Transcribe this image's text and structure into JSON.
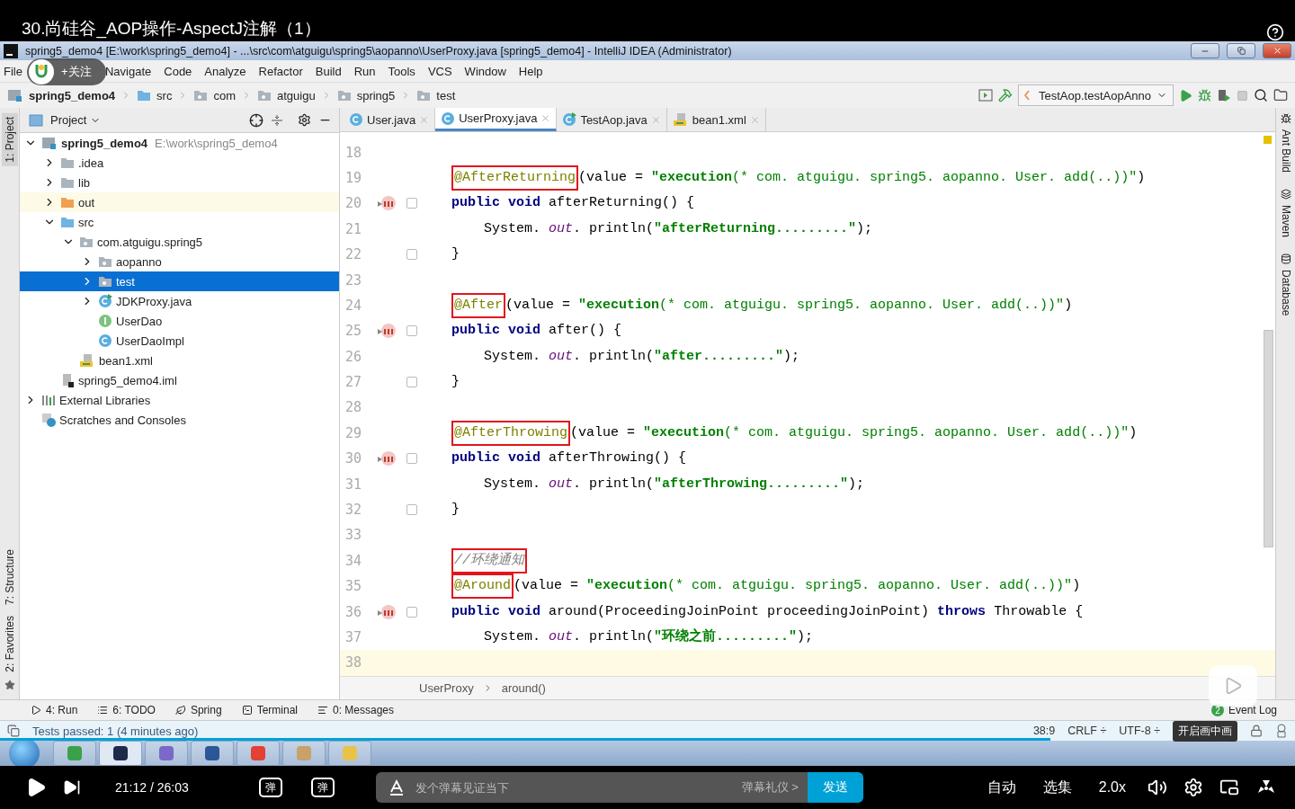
{
  "video_title": "30.尚硅谷_AOP操作-AspectJ注解（1）",
  "window": {
    "title": "spring5_demo4 [E:\\work\\spring5_demo4] - ...\\src\\com\\atguigu\\spring5\\aopanno\\UserProxy.java [spring5_demo4] - IntelliJ IDEA (Administrator)"
  },
  "menu": [
    "File",
    "Navigate",
    "Code",
    "Analyze",
    "Refactor",
    "Build",
    "Run",
    "Tools",
    "VCS",
    "Window",
    "Help"
  ],
  "follow_overlay": {
    "label": "+关注"
  },
  "nav_path": [
    {
      "label": "spring5_demo4",
      "kind": "module"
    },
    {
      "label": "src",
      "kind": "source"
    },
    {
      "label": "com",
      "kind": "package"
    },
    {
      "label": "atguigu",
      "kind": "package"
    },
    {
      "label": "spring5",
      "kind": "package"
    },
    {
      "label": "test",
      "kind": "package"
    }
  ],
  "run_config": "TestAop.testAopAnno",
  "left_strip": [
    {
      "label": "1: Project",
      "selected": true
    },
    {
      "label": "7: Structure",
      "selected": false
    },
    {
      "label": "2: Favorites",
      "selected": false
    }
  ],
  "right_strip": [
    {
      "label": "Ant Build",
      "kind": "ant"
    },
    {
      "label": "Maven",
      "kind": "maven"
    },
    {
      "label": "Database",
      "kind": "database"
    }
  ],
  "project_panel": {
    "title": "Project",
    "tree": [
      {
        "label": "spring5_demo4",
        "note": "E:\\work\\spring5_demo4",
        "kind": "module",
        "expanded": true,
        "selected": false,
        "children": [
          {
            "label": ".idea",
            "kind": "folder",
            "expanded": false,
            "selected": false
          },
          {
            "label": "lib",
            "kind": "folder",
            "expanded": false,
            "selected": false
          },
          {
            "label": "out",
            "kind": "excluded",
            "expanded": false,
            "selected": false
          },
          {
            "label": "src",
            "kind": "source",
            "expanded": true,
            "selected": false,
            "children": [
              {
                "label": "com.atguigu.spring5",
                "kind": "package",
                "expanded": true,
                "selected": false,
                "children": [
                  {
                    "label": "aopanno",
                    "kind": "package",
                    "expanded": false,
                    "selected": false
                  },
                  {
                    "label": "test",
                    "kind": "package",
                    "expanded": false,
                    "selected": true
                  },
                  {
                    "label": "JDKProxy.java",
                    "kind": "class-run",
                    "expanded": false,
                    "selected": false
                  },
                  {
                    "label": "UserDao",
                    "kind": "interface",
                    "selected": false
                  },
                  {
                    "label": "UserDaoImpl",
                    "kind": "class",
                    "selected": false
                  }
                ]
              },
              {
                "label": "bean1.xml",
                "kind": "xml",
                "selected": false
              }
            ]
          },
          {
            "label": "spring5_demo4.iml",
            "kind": "iml",
            "selected": false
          }
        ]
      },
      {
        "label": "External Libraries",
        "kind": "libraries",
        "expanded": false,
        "selected": false
      },
      {
        "label": "Scratches and Consoles",
        "kind": "scratches",
        "selected": false
      }
    ]
  },
  "editor_tabs": [
    {
      "label": "User.java",
      "kind": "class",
      "selected": false
    },
    {
      "label": "UserProxy.java",
      "kind": "class",
      "selected": true
    },
    {
      "label": "TestAop.java",
      "kind": "class-run",
      "selected": false
    },
    {
      "label": "bean1.xml",
      "kind": "xml",
      "selected": false
    }
  ],
  "code": [
    {
      "no": "18"
    },
    {
      "no": "19",
      "segments": [
        {
          "text": "@AfterReturning",
          "kind": "ann",
          "boxed": true
        },
        {
          "text": "(value = ",
          "kind": "plain"
        },
        {
          "text": "\"execution",
          "kind": "strb"
        },
        {
          "text": "(* com. atguigu. spring5. aopanno. User. add(..))\"",
          "kind": "str"
        },
        {
          "text": ")",
          "kind": "plain"
        }
      ]
    },
    {
      "no": "20",
      "advice_marker": true,
      "fold_marker": true,
      "segments": [
        {
          "text": "public void",
          "kind": "kw"
        },
        {
          "text": " afterReturning() {",
          "kind": "plain"
        }
      ],
      "children": [
        {
          "no": "21",
          "segments": [
            {
              "text": "System. ",
              "kind": "plain"
            },
            {
              "text": "out",
              "kind": "static"
            },
            {
              "text": ". println(",
              "kind": "plain"
            },
            {
              "text": "\"afterReturning.........\"",
              "kind": "strb"
            },
            {
              "text": ");",
              "kind": "plain"
            }
          ]
        }
      ]
    },
    {
      "no": "22",
      "fold_marker": true,
      "segments": [
        {
          "text": "}",
          "kind": "plain"
        }
      ]
    },
    {
      "no": "23"
    },
    {
      "no": "24",
      "segments": [
        {
          "text": "@After",
          "kind": "ann",
          "boxed": true
        },
        {
          "text": "(value = ",
          "kind": "plain"
        },
        {
          "text": "\"execution",
          "kind": "strb"
        },
        {
          "text": "(* com. atguigu. spring5. aopanno. User. add(..))\"",
          "kind": "str"
        },
        {
          "text": ")",
          "kind": "plain"
        }
      ]
    },
    {
      "no": "25",
      "advice_marker": true,
      "fold_marker": true,
      "segments": [
        {
          "text": "public void",
          "kind": "kw"
        },
        {
          "text": " after() {",
          "kind": "plain"
        }
      ],
      "children": [
        {
          "no": "26",
          "segments": [
            {
              "text": "System. ",
              "kind": "plain"
            },
            {
              "text": "out",
              "kind": "static"
            },
            {
              "text": ". println(",
              "kind": "plain"
            },
            {
              "text": "\"after.........\"",
              "kind": "strb"
            },
            {
              "text": ");",
              "kind": "plain"
            }
          ]
        }
      ]
    },
    {
      "no": "27",
      "fold_marker": true,
      "segments": [
        {
          "text": "}",
          "kind": "plain"
        }
      ]
    },
    {
      "no": "28"
    },
    {
      "no": "29",
      "segments": [
        {
          "text": "@AfterThrowing",
          "kind": "ann",
          "boxed": true
        },
        {
          "text": "(value = ",
          "kind": "plain"
        },
        {
          "text": "\"execution",
          "kind": "strb"
        },
        {
          "text": "(* com. atguigu. spring5. aopanno. User. add(..))\"",
          "kind": "str"
        },
        {
          "text": ")",
          "kind": "plain"
        }
      ]
    },
    {
      "no": "30",
      "advice_marker": true,
      "fold_marker": true,
      "segments": [
        {
          "text": "public void",
          "kind": "kw"
        },
        {
          "text": " afterThrowing() {",
          "kind": "plain"
        }
      ],
      "children": [
        {
          "no": "31",
          "segments": [
            {
              "text": "System. ",
              "kind": "plain"
            },
            {
              "text": "out",
              "kind": "static"
            },
            {
              "text": ". println(",
              "kind": "plain"
            },
            {
              "text": "\"afterThrowing.........\"",
              "kind": "strb"
            },
            {
              "text": ");",
              "kind": "plain"
            }
          ]
        }
      ]
    },
    {
      "no": "32",
      "fold_marker": true,
      "segments": [
        {
          "text": "}",
          "kind": "plain"
        }
      ]
    },
    {
      "no": "33"
    },
    {
      "no": "34",
      "segments": [
        {
          "text": "//环绕通知",
          "kind": "comment",
          "boxed": true
        }
      ]
    },
    {
      "no": "35",
      "segments": [
        {
          "text": "@Around",
          "kind": "ann",
          "boxed": true
        },
        {
          "text": "(value = ",
          "kind": "plain"
        },
        {
          "text": "\"execution",
          "kind": "strb"
        },
        {
          "text": "(* com. atguigu. spring5. aopanno. User. add(..))\"",
          "kind": "str"
        },
        {
          "text": ")",
          "kind": "plain"
        }
      ]
    },
    {
      "no": "36",
      "advice_marker": true,
      "fold_marker": true,
      "segments": [
        {
          "text": "public void",
          "kind": "kw"
        },
        {
          "text": " around(ProceedingJoinPoint proceedingJoinPoint) ",
          "kind": "plain"
        },
        {
          "text": "throws",
          "kind": "kw"
        },
        {
          "text": " Throwable {",
          "kind": "plain"
        }
      ],
      "children": [
        {
          "no": "37",
          "segments": [
            {
              "text": "System. ",
              "kind": "plain"
            },
            {
              "text": "out",
              "kind": "static"
            },
            {
              "text": ". println(",
              "kind": "plain"
            },
            {
              "text": "\"环绕之前.........\"",
              "kind": "strb"
            },
            {
              "text": ");",
              "kind": "plain"
            }
          ]
        }
      ]
    },
    {
      "no": "38",
      "current": true
    }
  ],
  "editor_breadcrumb": [
    "UserProxy",
    "around()"
  ],
  "tool_tabs": [
    {
      "label": "4: Run",
      "kind": "run"
    },
    {
      "label": "6: TODO",
      "kind": "todo"
    },
    {
      "label": "Spring",
      "kind": "spring"
    },
    {
      "label": "Terminal",
      "kind": "terminal"
    },
    {
      "label": "0: Messages",
      "kind": "messages"
    }
  ],
  "event_log": {
    "label": "Event Log",
    "count": "2"
  },
  "status_bar": {
    "message": "Tests passed: 1 (4 minutes ago)",
    "position": "38:9",
    "line_sep": "CRLF ÷",
    "encoding": "UTF-8 ÷"
  },
  "pip_tooltip": "开启画中画",
  "player": {
    "progress": {
      "level": 0.811
    },
    "time": "21:12 / 26:03",
    "danmaku_toggles": [
      "弹",
      "弹"
    ],
    "danmaku_input": {
      "placeholder": "发个弹幕见证当下"
    },
    "etiquette": "弹幕礼仪 >",
    "send": "发送",
    "controls": [
      "自动",
      "选集",
      "2.0x"
    ]
  }
}
